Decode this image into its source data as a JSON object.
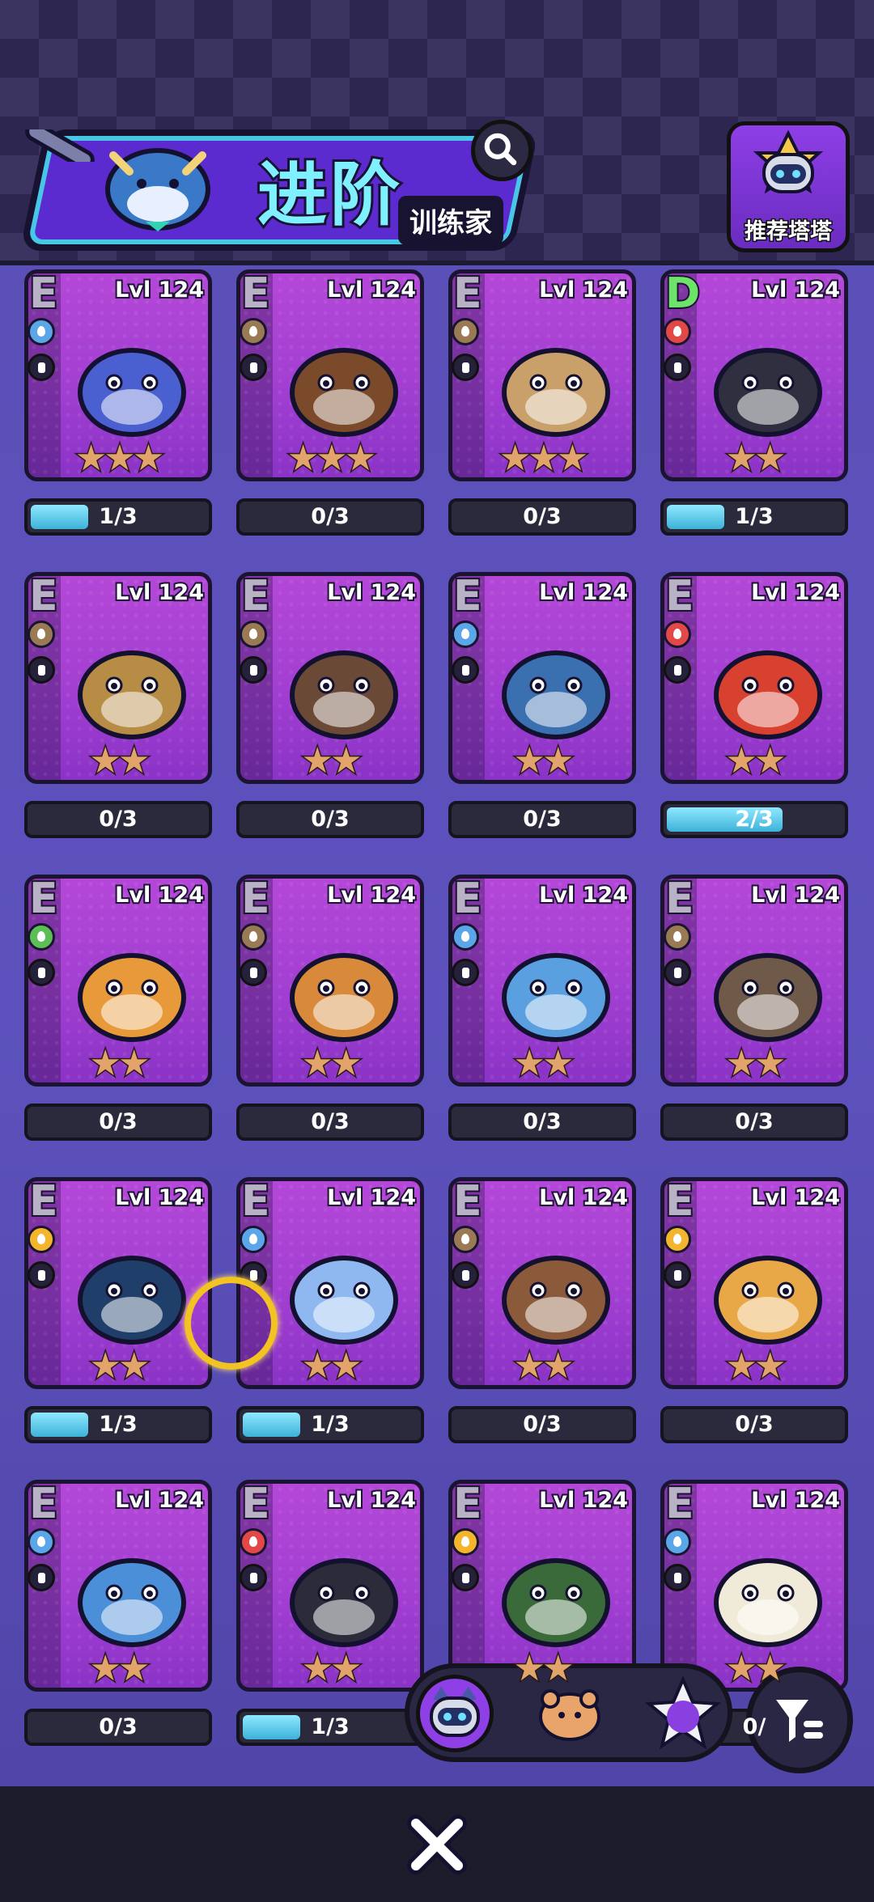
{
  "header": {
    "title_main": "进阶",
    "title_sub": "训练家",
    "recommend_label": "推荐塔塔"
  },
  "cards": [
    {
      "grade": "E",
      "level": "Lvl 124",
      "element": "water",
      "role": "support",
      "stars": 3,
      "progress": "1/3",
      "fill": 0.33,
      "color": "#4a5fd0"
    },
    {
      "grade": "E",
      "level": "Lvl 124",
      "element": "earth",
      "role": "attack",
      "stars": 3,
      "progress": "0/3",
      "fill": 0,
      "color": "#7a4a2a"
    },
    {
      "grade": "E",
      "level": "Lvl 124",
      "element": "earth",
      "role": "defense",
      "stars": 3,
      "progress": "0/3",
      "fill": 0,
      "color": "#caa06a"
    },
    {
      "grade": "D",
      "level": "Lvl 124",
      "element": "fire",
      "role": "support",
      "stars": 2,
      "progress": "1/3",
      "fill": 0.33,
      "color": "#2f2f3f"
    },
    {
      "grade": "E",
      "level": "Lvl 124",
      "element": "earth",
      "role": "support",
      "stars": 2,
      "progress": "0/3",
      "fill": 0,
      "color": "#b78d45"
    },
    {
      "grade": "E",
      "level": "Lvl 124",
      "element": "earth",
      "role": "support",
      "stars": 2,
      "progress": "0/3",
      "fill": 0,
      "color": "#6a4a36"
    },
    {
      "grade": "E",
      "level": "Lvl 124",
      "element": "water",
      "role": "defense",
      "stars": 2,
      "progress": "0/3",
      "fill": 0,
      "color": "#3a6fb0"
    },
    {
      "grade": "E",
      "level": "Lvl 124",
      "element": "fire",
      "role": "attack",
      "stars": 2,
      "progress": "2/3",
      "fill": 0.66,
      "color": "#d84030"
    },
    {
      "grade": "E",
      "level": "Lvl 124",
      "element": "grass",
      "role": "heal",
      "stars": 2,
      "progress": "0/3",
      "fill": 0,
      "color": "#e89a3a"
    },
    {
      "grade": "E",
      "level": "Lvl 124",
      "element": "earth",
      "role": "support",
      "stars": 2,
      "progress": "0/3",
      "fill": 0,
      "color": "#d88a3a"
    },
    {
      "grade": "E",
      "level": "Lvl 124",
      "element": "water",
      "role": "ranged",
      "stars": 2,
      "progress": "0/3",
      "fill": 0,
      "color": "#5aa0e0"
    },
    {
      "grade": "E",
      "level": "Lvl 124",
      "element": "earth",
      "role": "attack",
      "stars": 2,
      "progress": "0/3",
      "fill": 0,
      "color": "#6f5a4a"
    },
    {
      "grade": "E",
      "level": "Lvl 124",
      "element": "elec",
      "role": "attack",
      "stars": 2,
      "progress": "1/3",
      "fill": 0.33,
      "color": "#1f3f6a"
    },
    {
      "grade": "E",
      "level": "Lvl 124",
      "element": "water",
      "role": "attack",
      "stars": 2,
      "progress": "1/3",
      "fill": 0.33,
      "color": "#8fb8f0"
    },
    {
      "grade": "E",
      "level": "Lvl 124",
      "element": "earth",
      "role": "attack",
      "stars": 2,
      "progress": "0/3",
      "fill": 0,
      "color": "#8a5a3a"
    },
    {
      "grade": "E",
      "level": "Lvl 124",
      "element": "elec",
      "role": "support",
      "stars": 2,
      "progress": "0/3",
      "fill": 0,
      "color": "#e8a848"
    },
    {
      "grade": "E",
      "level": "Lvl 124",
      "element": "water",
      "role": "attack",
      "stars": 2,
      "progress": "0/3",
      "fill": 0,
      "color": "#4a8fd8"
    },
    {
      "grade": "E",
      "level": "Lvl 124",
      "element": "fire",
      "role": "attack",
      "stars": 2,
      "progress": "1/3",
      "fill": 0.33,
      "color": "#2b2b3a"
    },
    {
      "grade": "E",
      "level": "Lvl 124",
      "element": "elec",
      "role": "heal",
      "stars": 2,
      "progress": "",
      "fill": 0,
      "color": "#3a6a3a"
    },
    {
      "grade": "E",
      "level": "Lvl 124",
      "element": "water",
      "role": "defense",
      "stars": 2,
      "progress": "0/",
      "fill": 0,
      "color": "#f0ead8"
    }
  ],
  "tabs": [
    {
      "name": "cat-tab",
      "active": true
    },
    {
      "name": "bear-tab",
      "active": false
    },
    {
      "name": "star-tab",
      "active": false
    }
  ],
  "colors": {
    "accent": "#8e3fe6",
    "progress_fill": "#3db2d8",
    "card_bg": "#a23fd2"
  }
}
